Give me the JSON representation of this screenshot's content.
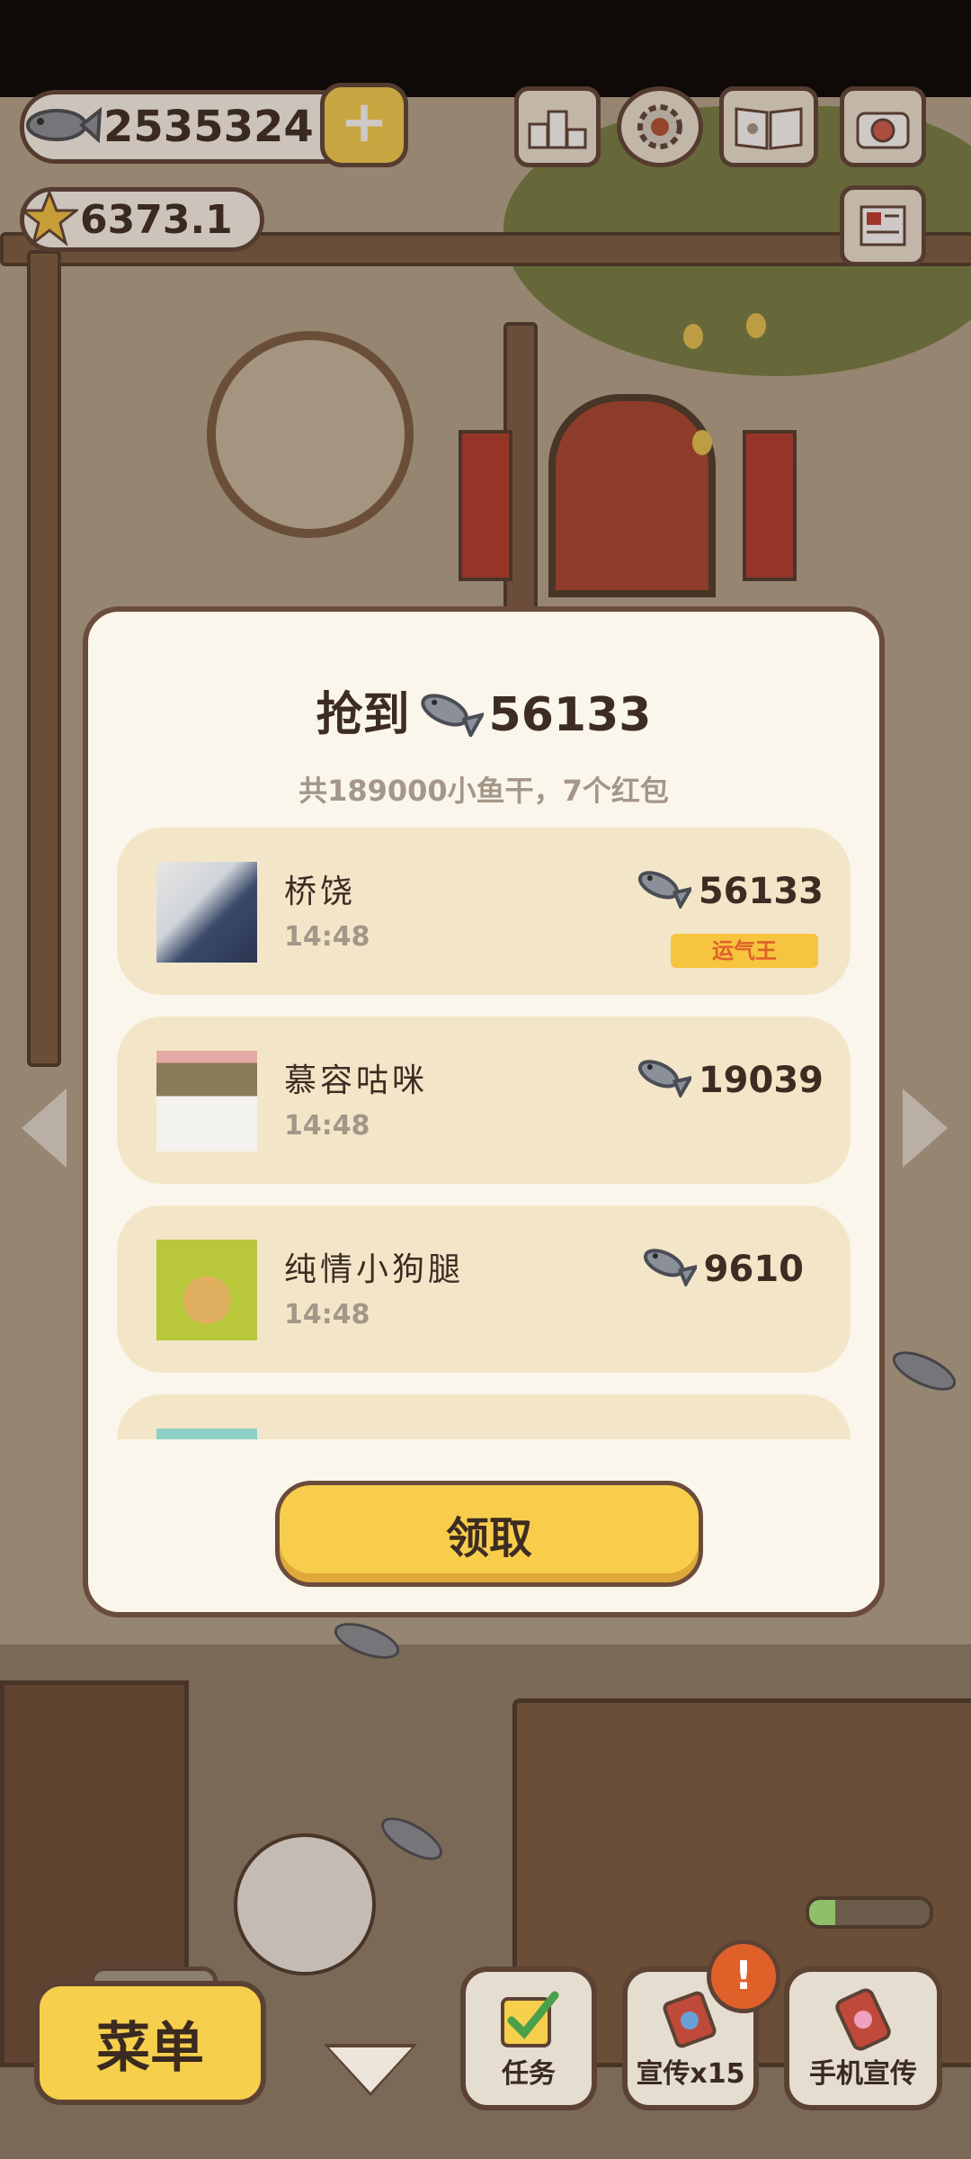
{
  "hud": {
    "fish_coins": "2535324",
    "stars": "6373.1"
  },
  "modal": {
    "title_prefix": "抢到",
    "title_amount": "56133",
    "subtitle": "共189000小鱼干，7个红包",
    "entries": [
      {
        "name": "桥饶",
        "time": "14:48",
        "amount": "56133",
        "badge": "运气王"
      },
      {
        "name": "慕容咕咪",
        "time": "14:48",
        "amount": "19039"
      },
      {
        "name": "纯情小狗腿",
        "time": "14:48",
        "amount": "9610"
      }
    ],
    "claim_label": "领取"
  },
  "bottom": {
    "menu_label": "菜单",
    "task_label": "任务",
    "promo_label": "宣传x15",
    "phone_promo_label": "手机宣传",
    "alert": "!"
  },
  "colors": {
    "panel_bg": "#fbf6ec",
    "row_bg": "#f3e6c8",
    "button_yellow": "#f8cd4c",
    "badge_yellow": "#f6c43f",
    "badge_text": "#e0602a",
    "border_brown": "#6b4c3b"
  }
}
